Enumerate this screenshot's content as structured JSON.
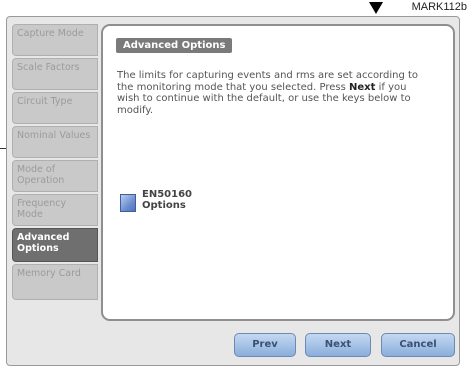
{
  "callout": {
    "label": "MARK112b"
  },
  "sidebar": {
    "items": [
      {
        "label": "Capture Mode",
        "active": false
      },
      {
        "label": "Scale Factors",
        "active": false
      },
      {
        "label": "Circuit Type",
        "active": false
      },
      {
        "label": "Nominal Values",
        "active": false
      },
      {
        "label": "Mode of Operation",
        "active": false
      },
      {
        "label": "Frequency Mode",
        "active": false
      },
      {
        "label": "Advanced Options",
        "active": true
      },
      {
        "label": "Memory Card",
        "active": false
      }
    ]
  },
  "panel": {
    "title": "Advanced Options",
    "body_1": "The limits for capturing events and rms are set according to the monitoring mode that you selected. Press ",
    "body_bold": "Next",
    "body_2": " if you wish to continue with the default, or use the keys below to modify.",
    "option_line_1": "EN50160",
    "option_line_2": "Options"
  },
  "buttons": {
    "prev": "Prev",
    "next": "Next",
    "cancel": "Cancel"
  }
}
